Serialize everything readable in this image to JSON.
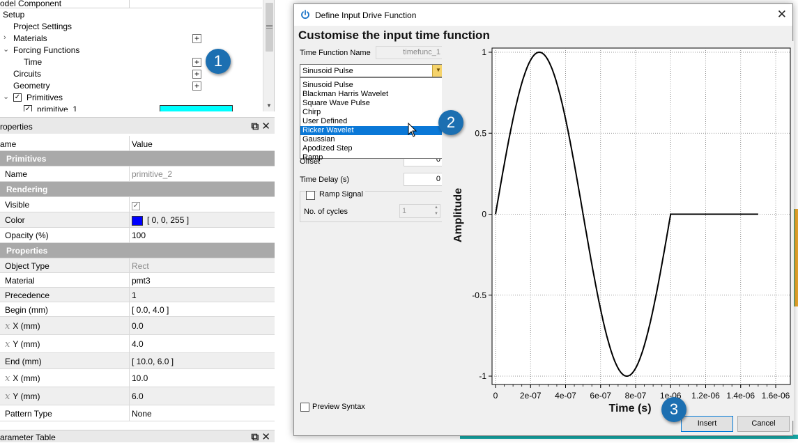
{
  "tree": {
    "header": "odel Component",
    "items": [
      {
        "label": "Setup"
      },
      {
        "label": "Project Settings"
      },
      {
        "label": "Materials"
      },
      {
        "label": "Forcing Functions"
      },
      {
        "label": "Time"
      },
      {
        "label": "Circuits"
      },
      {
        "label": "Geometry"
      },
      {
        "label": "Primitives"
      },
      {
        "label": "primitive_1"
      }
    ],
    "plus_glyph": "+",
    "primitive_1_color": "#00ffff"
  },
  "properties_panel": {
    "title": "roperties",
    "col_name": "ame",
    "col_value": "Value",
    "rows": [
      {
        "group": "Primitives"
      },
      {
        "name": "Name",
        "value": "primitive_2"
      },
      {
        "group": "Rendering"
      },
      {
        "name": "Visible",
        "value": "✓"
      },
      {
        "name": "Color",
        "value": "[ 0, 0, 255 ]",
        "swatch": "#0000ff"
      },
      {
        "name": "Opacity (%)",
        "value": "100"
      },
      {
        "group": "Properties"
      },
      {
        "name": "Object Type",
        "value": "Rect"
      },
      {
        "name": "Material",
        "value": "pmt3"
      },
      {
        "name": "Precedence",
        "value": "1"
      },
      {
        "name": "Begin (mm)",
        "value": "[ 0.0, 4.0 ]"
      },
      {
        "name": "X (mm)",
        "value": "0.0",
        "sym": "x"
      },
      {
        "name": "Y (mm)",
        "value": "4.0",
        "sym": "x"
      },
      {
        "name": "End (mm)",
        "value": "[ 10.0, 6.0 ]"
      },
      {
        "name": "X (mm)",
        "value": "10.0",
        "sym": "x"
      },
      {
        "name": "Y (mm)",
        "value": "6.0",
        "sym": "x"
      },
      {
        "name": "Pattern Type",
        "value": "None"
      }
    ],
    "dock_float": "⧉",
    "dock_close": "✕"
  },
  "parameter_table": {
    "title": "arameter Table"
  },
  "dialog": {
    "title": "Define Input Drive Function",
    "close": "✕",
    "heading": "Customise the input time function",
    "time_function_name_label": "Time Function Name",
    "time_function_name_value": "timefunc_1",
    "combo_value": "Sinusoid Pulse",
    "combo_arrow": "▼",
    "dropdown_options": [
      "Sinusoid Pulse",
      "Blackman Harris Wavelet",
      "Square Wave Pulse",
      "Chirp",
      "User Defined",
      "Ricker Wavelet",
      "Gaussian",
      "Apodized Step",
      "Ramp"
    ],
    "dropdown_selected_index": 5,
    "offset_label": "Offset",
    "offset_value": "0",
    "time_delay_label": "Time Delay (s)",
    "time_delay_value": "0",
    "ramp_signal_label": "Ramp Signal",
    "cycles_label": "No. of cycles",
    "cycles_value": "1",
    "preview_syntax_label": "Preview Syntax",
    "insert_label": "Insert",
    "cancel_label": "Cancel"
  },
  "callouts": [
    "1",
    "2",
    "3"
  ],
  "chart_data": {
    "type": "line",
    "title": "",
    "xlabel": "Time (s)",
    "ylabel": "Amplitude",
    "xlim": [
      0,
      1.6e-06
    ],
    "ylim": [
      -1,
      1
    ],
    "x_ticks": [
      0,
      2e-07,
      4e-07,
      6e-07,
      8e-07,
      1e-06,
      1.2e-06,
      1.4e-06,
      1.6e-06
    ],
    "x_tick_labels": [
      "0",
      "2e-07",
      "4e-07",
      "6e-07",
      "8e-07",
      "1e-06",
      "1.2e-06",
      "1.4e-06",
      "1.6e-06"
    ],
    "y_ticks": [
      -1,
      -0.5,
      0,
      0.5,
      1
    ],
    "y_tick_labels": [
      "-1",
      "-0.5",
      "0",
      "0.5",
      "1"
    ],
    "grid": true,
    "series": [
      {
        "color": "#000000",
        "function": "sin(2*pi*t/1e-6) for t<=1e-6, else 0",
        "x": [
          0,
          1e-07,
          2e-07,
          2.5e-07,
          3e-07,
          4e-07,
          5e-07,
          6e-07,
          7e-07,
          7.5e-07,
          8e-07,
          9e-07,
          1e-06,
          1.2e-06,
          1.5e-06
        ],
        "y": [
          0,
          0.588,
          0.951,
          1,
          0.951,
          0.588,
          0,
          -0.588,
          -0.951,
          -1,
          -0.951,
          -0.588,
          0,
          0,
          0
        ]
      }
    ]
  }
}
